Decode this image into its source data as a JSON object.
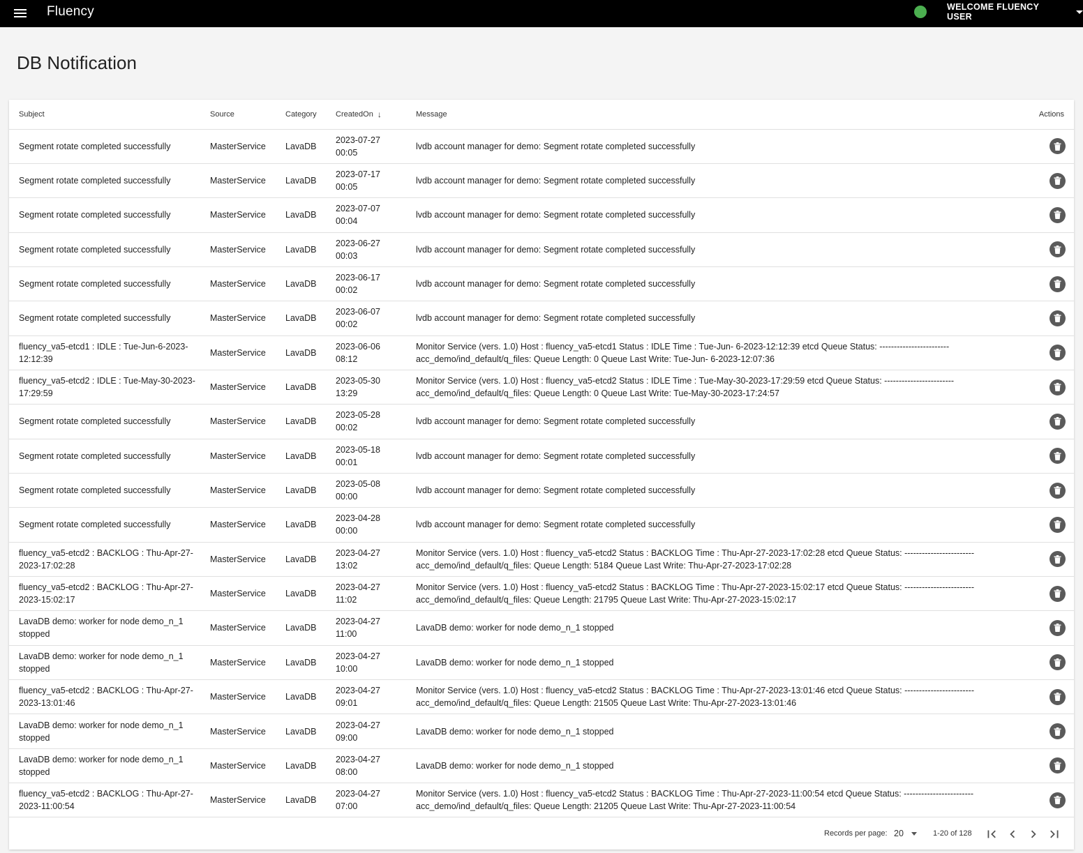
{
  "app": {
    "title": "Fluency",
    "user_label": "WELCOME FLUENCY USER",
    "status_color": "#4caf50"
  },
  "page": {
    "title": "DB Notification"
  },
  "table": {
    "headers": {
      "subject": "Subject",
      "source": "Source",
      "category": "Category",
      "created": "CreatedOn",
      "message": "Message",
      "actions": "Actions"
    },
    "sort": {
      "column": "CreatedOn",
      "direction": "descending"
    },
    "rows": [
      {
        "subject": "Segment rotate completed successfully",
        "source": "MasterService",
        "category": "LavaDB",
        "date": "2023-07-27",
        "time": "00:05",
        "message": "lvdb account manager for demo: Segment rotate completed successfully"
      },
      {
        "subject": "Segment rotate completed successfully",
        "source": "MasterService",
        "category": "LavaDB",
        "date": "2023-07-17",
        "time": "00:05",
        "message": "lvdb account manager for demo: Segment rotate completed successfully"
      },
      {
        "subject": "Segment rotate completed successfully",
        "source": "MasterService",
        "category": "LavaDB",
        "date": "2023-07-07",
        "time": "00:04",
        "message": "lvdb account manager for demo: Segment rotate completed successfully"
      },
      {
        "subject": "Segment rotate completed successfully",
        "source": "MasterService",
        "category": "LavaDB",
        "date": "2023-06-27",
        "time": "00:03",
        "message": "lvdb account manager for demo: Segment rotate completed successfully"
      },
      {
        "subject": "Segment rotate completed successfully",
        "source": "MasterService",
        "category": "LavaDB",
        "date": "2023-06-17",
        "time": "00:02",
        "message": "lvdb account manager for demo: Segment rotate completed successfully"
      },
      {
        "subject": "Segment rotate completed successfully",
        "source": "MasterService",
        "category": "LavaDB",
        "date": "2023-06-07",
        "time": "00:02",
        "message": "lvdb account manager for demo: Segment rotate completed successfully"
      },
      {
        "subject": "fluency_va5-etcd1 : IDLE : Tue-Jun-6-2023-12:12:39",
        "source": "MasterService",
        "category": "LavaDB",
        "date": "2023-06-06",
        "time": "08:12",
        "message": "Monitor Service (vers. 1.0) Host : fluency_va5-etcd1 Status : IDLE Time : Tue-Jun- 6-2023-12:12:39 etcd Queue Status: ------------------------ acc_demo/ind_default/q_files: Queue Length: 0 Queue Last Write: Tue-Jun- 6-2023-12:07:36"
      },
      {
        "subject": "fluency_va5-etcd2 : IDLE : Tue-May-30-2023-17:29:59",
        "source": "MasterService",
        "category": "LavaDB",
        "date": "2023-05-30",
        "time": "13:29",
        "message": "Monitor Service (vers. 1.0) Host : fluency_va5-etcd2 Status : IDLE Time : Tue-May-30-2023-17:29:59 etcd Queue Status: ------------------------ acc_demo/ind_default/q_files: Queue Length: 0 Queue Last Write: Tue-May-30-2023-17:24:57"
      },
      {
        "subject": "Segment rotate completed successfully",
        "source": "MasterService",
        "category": "LavaDB",
        "date": "2023-05-28",
        "time": "00:02",
        "message": "lvdb account manager for demo: Segment rotate completed successfully"
      },
      {
        "subject": "Segment rotate completed successfully",
        "source": "MasterService",
        "category": "LavaDB",
        "date": "2023-05-18",
        "time": "00:01",
        "message": "lvdb account manager for demo: Segment rotate completed successfully"
      },
      {
        "subject": "Segment rotate completed successfully",
        "source": "MasterService",
        "category": "LavaDB",
        "date": "2023-05-08",
        "time": "00:00",
        "message": "lvdb account manager for demo: Segment rotate completed successfully"
      },
      {
        "subject": "Segment rotate completed successfully",
        "source": "MasterService",
        "category": "LavaDB",
        "date": "2023-04-28",
        "time": "00:00",
        "message": "lvdb account manager for demo: Segment rotate completed successfully"
      },
      {
        "subject": "fluency_va5-etcd2 : BACKLOG : Thu-Apr-27-2023-17:02:28",
        "source": "MasterService",
        "category": "LavaDB",
        "date": "2023-04-27",
        "time": "13:02",
        "message": "Monitor Service (vers. 1.0) Host : fluency_va5-etcd2 Status : BACKLOG Time : Thu-Apr-27-2023-17:02:28 etcd Queue Status: ------------------------ acc_demo/ind_default/q_files: Queue Length: 5184 Queue Last Write: Thu-Apr-27-2023-17:02:28"
      },
      {
        "subject": "fluency_va5-etcd2 : BACKLOG : Thu-Apr-27-2023-15:02:17",
        "source": "MasterService",
        "category": "LavaDB",
        "date": "2023-04-27",
        "time": "11:02",
        "message": "Monitor Service (vers. 1.0) Host : fluency_va5-etcd2 Status : BACKLOG Time : Thu-Apr-27-2023-15:02:17 etcd Queue Status: ------------------------ acc_demo/ind_default/q_files: Queue Length: 21795 Queue Last Write: Thu-Apr-27-2023-15:02:17"
      },
      {
        "subject": "LavaDB demo: worker for node demo_n_1 stopped",
        "source": "MasterService",
        "category": "LavaDB",
        "date": "2023-04-27",
        "time": "11:00",
        "message": "LavaDB demo: worker for node demo_n_1 stopped"
      },
      {
        "subject": "LavaDB demo: worker for node demo_n_1 stopped",
        "source": "MasterService",
        "category": "LavaDB",
        "date": "2023-04-27",
        "time": "10:00",
        "message": "LavaDB demo: worker for node demo_n_1 stopped"
      },
      {
        "subject": "fluency_va5-etcd2 : BACKLOG : Thu-Apr-27-2023-13:01:46",
        "source": "MasterService",
        "category": "LavaDB",
        "date": "2023-04-27",
        "time": "09:01",
        "message": "Monitor Service (vers. 1.0) Host : fluency_va5-etcd2 Status : BACKLOG Time : Thu-Apr-27-2023-13:01:46 etcd Queue Status: ------------------------ acc_demo/ind_default/q_files: Queue Length: 21505 Queue Last Write: Thu-Apr-27-2023-13:01:46"
      },
      {
        "subject": "LavaDB demo: worker for node demo_n_1 stopped",
        "source": "MasterService",
        "category": "LavaDB",
        "date": "2023-04-27",
        "time": "09:00",
        "message": "LavaDB demo: worker for node demo_n_1 stopped"
      },
      {
        "subject": "LavaDB demo: worker for node demo_n_1 stopped",
        "source": "MasterService",
        "category": "LavaDB",
        "date": "2023-04-27",
        "time": "08:00",
        "message": "LavaDB demo: worker for node demo_n_1 stopped"
      },
      {
        "subject": "fluency_va5-etcd2 : BACKLOG : Thu-Apr-27-2023-11:00:54",
        "source": "MasterService",
        "category": "LavaDB",
        "date": "2023-04-27",
        "time": "07:00",
        "message": "Monitor Service (vers. 1.0) Host : fluency_va5-etcd2 Status : BACKLOG Time : Thu-Apr-27-2023-11:00:54 etcd Queue Status: ------------------------ acc_demo/ind_default/q_files: Queue Length: 21205 Queue Last Write: Thu-Apr-27-2023-11:00:54"
      }
    ]
  },
  "icons": {
    "menu": "menu-icon",
    "sort": "arrow-down-icon",
    "delete": "trash-icon",
    "first": "first-page-icon",
    "prev": "chevron-left-icon",
    "next": "chevron-right-icon",
    "last": "last-page-icon"
  },
  "pagination": {
    "records_label": "Records per page:",
    "per_page": "20",
    "range": "1-20 of 128"
  }
}
